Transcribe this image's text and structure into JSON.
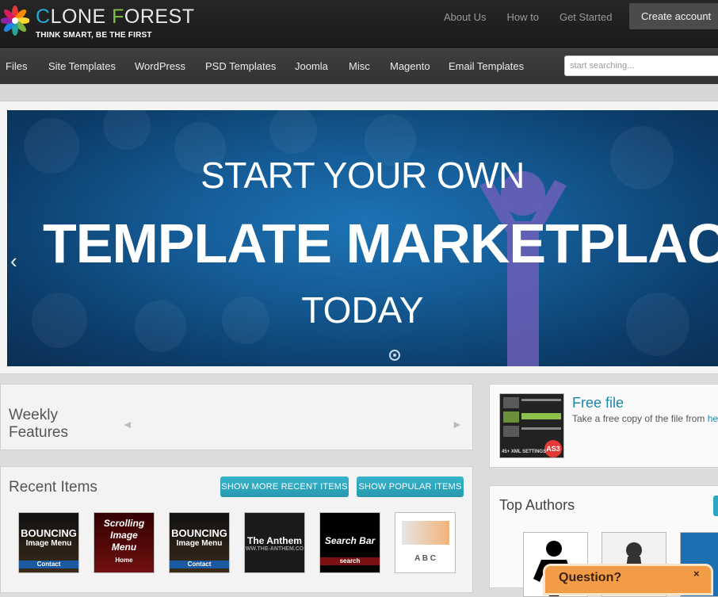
{
  "header": {
    "brand_first_letter": "C",
    "brand_mid": "LONE ",
    "brand_f": "F",
    "brand_rest": "OREST",
    "tagline": "THINK SMART, BE THE FIRST",
    "links": [
      "About Us",
      "How to",
      "Get Started"
    ],
    "create_account": "Create account"
  },
  "nav": {
    "items": [
      "Files",
      "Site Templates",
      "WordPress",
      "PSD Templates",
      "Joomla",
      "Misc",
      "Magento",
      "Email Templates"
    ],
    "search_placeholder": "start searching..."
  },
  "hero": {
    "line1": "START YOUR OWN",
    "line2": "TEMPLATE MARKETPLACE",
    "line3": "TODAY",
    "prev_arrow": "‹"
  },
  "weekly": {
    "title": "Weekly Features",
    "prev": "◄",
    "next": "►"
  },
  "recent": {
    "title": "Recent Items",
    "btn_recent": "SHOW MORE RECENT ITEMS",
    "btn_popular": "SHOW POPULAR ITEMS",
    "thumbs": [
      {
        "lines": [
          "BOUNCING",
          "Image Menu"
        ],
        "footer": "Contact"
      },
      {
        "lines": [
          "Scrolling",
          "Image",
          "Menu"
        ],
        "footer": "Home"
      },
      {
        "lines": [
          "BOUNCING",
          "Image Menu"
        ],
        "footer": "Contact"
      },
      {
        "lines": [
          "The Anthem",
          "WW.THE-ANTHEM.CO"
        ],
        "footer": ""
      },
      {
        "lines": [
          "Search Bar"
        ],
        "footer": "search"
      },
      {
        "lines": [
          "A B C"
        ],
        "footer": ""
      }
    ]
  },
  "freefile": {
    "title": "Free file",
    "desc": "Take a free copy of the file from ",
    "desc_link": "he",
    "thumb_badge": "AS3",
    "thumb_caption": "45+ XML SETTINGS"
  },
  "authors": {
    "title": "Top Authors"
  },
  "question": {
    "label": "Question?",
    "close": "×"
  },
  "colors": {
    "accent": "#2aa8c3",
    "topbar": "#262626",
    "navbar": "#3a3a3a",
    "hero": "#155d98"
  }
}
